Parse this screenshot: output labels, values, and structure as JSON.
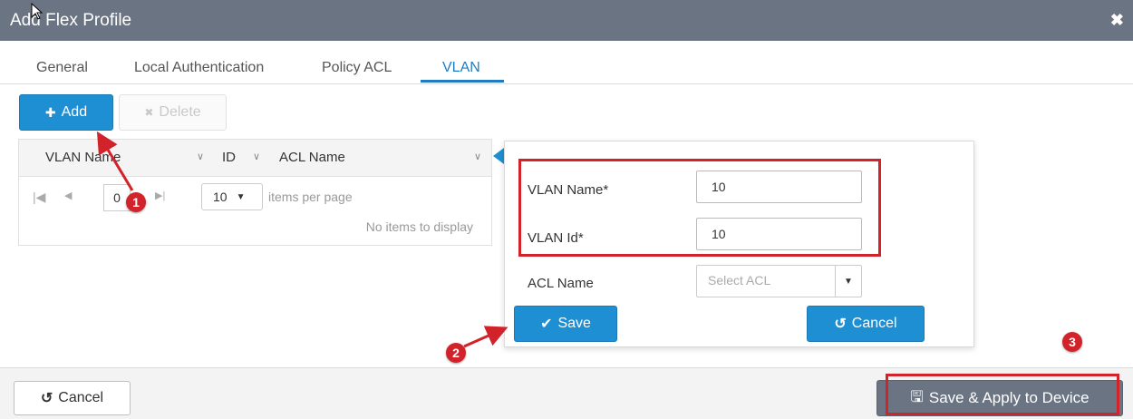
{
  "dialog": {
    "title": "Add Flex Profile",
    "close_glyph": "✖"
  },
  "tabs": [
    {
      "label": "General",
      "active": false
    },
    {
      "label": "Local Authentication",
      "active": false
    },
    {
      "label": "Policy ACL",
      "active": false
    },
    {
      "label": "VLAN",
      "active": true
    }
  ],
  "toolbar": {
    "add_icon": "✚",
    "add_label": "Add",
    "delete_icon": "✖",
    "delete_label": "Delete"
  },
  "grid": {
    "columns": [
      "VLAN Name",
      "ID",
      "ACL Name"
    ],
    "chevron": "∨",
    "pager": {
      "first": "|◀",
      "prev": "◀",
      "page_value": "0",
      "next": "▶",
      "last": "▶|",
      "items_per_page_value": "10",
      "items_per_page_label": "items per page",
      "empty_text": "No items to display"
    }
  },
  "form": {
    "vlan_name_label": "VLAN Name*",
    "vlan_name_value": "10",
    "vlan_id_label": "VLAN Id*",
    "vlan_id_value": "10",
    "acl_label": "ACL Name",
    "acl_placeholder": "Select ACL",
    "save_icon": "✔",
    "save_label": "Save",
    "cancel_icon": "↺",
    "cancel_label": "Cancel"
  },
  "annotations": {
    "step1": "1",
    "step2": "2",
    "step3": "3",
    "color": "#d2232a"
  },
  "footer": {
    "cancel_icon": "↺",
    "cancel_label": "Cancel",
    "apply_icon": "🖫",
    "apply_label": "Save & Apply to Device"
  },
  "colors": {
    "header_bg": "#6a7482",
    "primary": "#1f8fd3",
    "accent": "#1f7cc1"
  }
}
